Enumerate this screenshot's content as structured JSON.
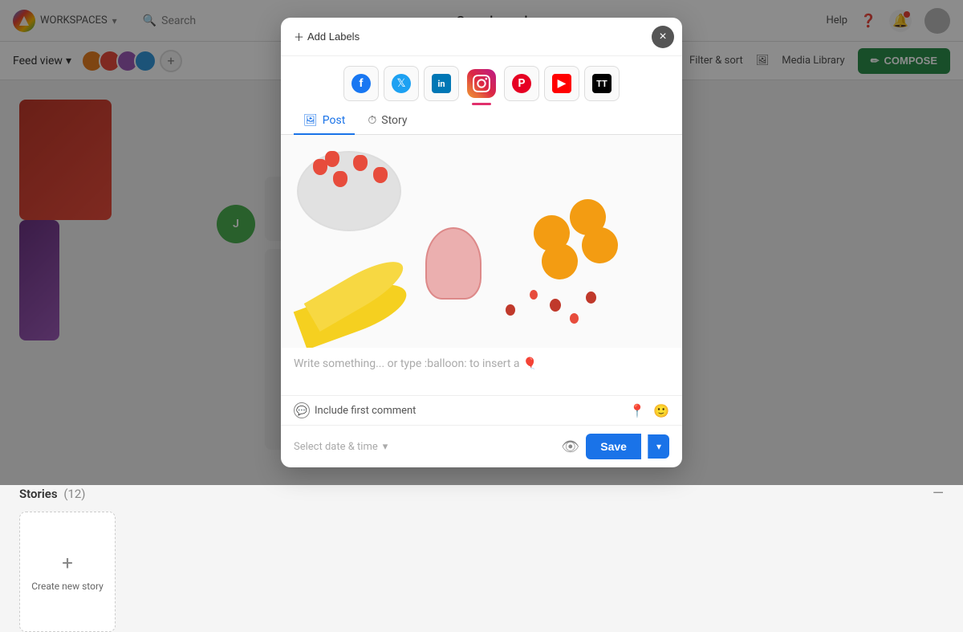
{
  "app": {
    "title": "Sample workspace",
    "workspaces_label": "WORKSPACES",
    "help_label": "Help",
    "compose_label": "COMPOSE"
  },
  "nav": {
    "search_placeholder": "Search",
    "feed_view_label": "Feed view",
    "filter_sort_label": "Filter & sort",
    "media_library_label": "Media Library"
  },
  "stories": {
    "title": "Stories",
    "count": "(12)",
    "create_label": "Create new story"
  },
  "modal": {
    "add_labels": "Add Labels",
    "close_label": "×",
    "tab_post": "Post",
    "tab_story": "Story",
    "write_placeholder": "Write something... or type :balloon: to insert a",
    "balloon_emoji": "🎈",
    "include_comment": "Include first comment",
    "date_placeholder": "Select date & time",
    "save_label": "Save"
  },
  "platforms": [
    {
      "id": "facebook",
      "label": "Facebook",
      "active": false
    },
    {
      "id": "twitter",
      "label": "Twitter",
      "active": false
    },
    {
      "id": "linkedin",
      "label": "LinkedIn",
      "active": false
    },
    {
      "id": "instagram",
      "label": "Instagram",
      "active": true
    },
    {
      "id": "pinterest",
      "label": "Pinterest",
      "active": false
    },
    {
      "id": "youtube",
      "label": "YouTube",
      "active": false
    },
    {
      "id": "tiktok",
      "label": "TikTok",
      "active": false
    }
  ]
}
